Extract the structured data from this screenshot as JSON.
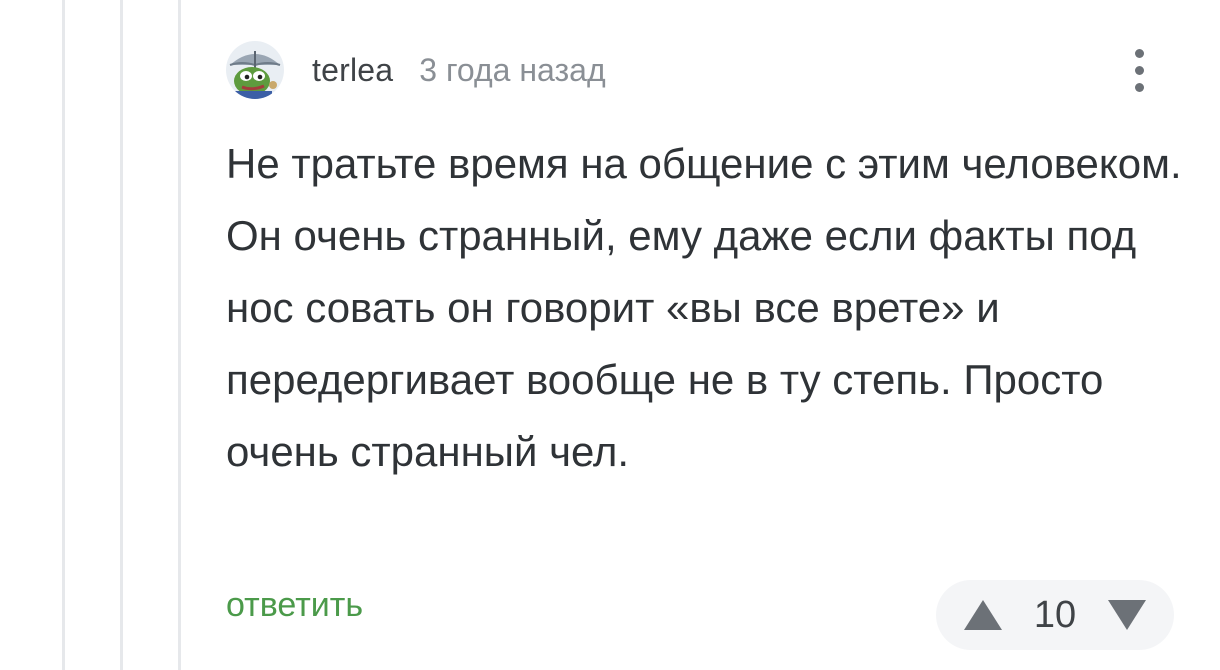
{
  "comment": {
    "author": "terlea",
    "timestamp": "3 года назад",
    "text": "Не тратьте время на общение с этим человеком. Он очень странный, ему даже если факты под нос совать он говорит «вы все врете» и передергивает вообще не в ту степь. Просто очень странный чел.",
    "reply_label": "ответить",
    "rating": "10"
  },
  "icons": {
    "avatar": "pepe-umbrella-avatar",
    "more": "more-vertical-icon",
    "upvote": "triangle-up-icon",
    "downvote": "triangle-down-icon"
  },
  "colors": {
    "reply": "#4b9a4a",
    "text": "#2f3337",
    "muted": "#8a8f95",
    "rating_bg": "#f4f5f7"
  }
}
